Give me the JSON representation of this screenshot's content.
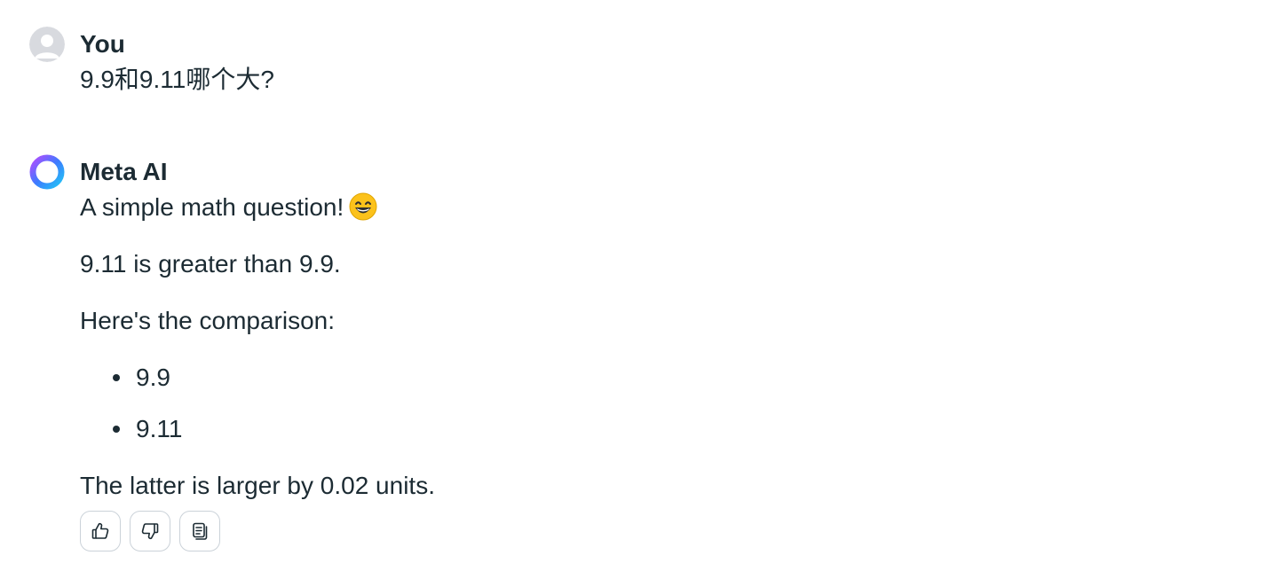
{
  "user_message": {
    "author": "You",
    "text": "9.9和9.11哪个大?",
    "avatar_icon": "default-user-avatar-icon"
  },
  "ai_message": {
    "author": "Meta AI",
    "avatar_icon": "meta-ai-ring-icon",
    "intro": "A simple math question!",
    "intro_emoji": "grinning-face-with-smiling-eyes-emoji",
    "answer": "9.11 is greater than 9.9.",
    "comparison_heading": "Here's the comparison:",
    "comparison_items": [
      "9.9",
      "9.11"
    ],
    "conclusion": "The latter is larger by 0.02 units."
  },
  "actions": {
    "like_icon": "thumbs-up-icon",
    "dislike_icon": "thumbs-down-icon",
    "copy_icon": "copy-icon"
  },
  "colors": {
    "text": "#1c2b33",
    "button_border": "#cbd2d9",
    "avatar_gray": "#d8dadf",
    "ring_gradient": [
      "#b24dff",
      "#3d7bff",
      "#22c3f5"
    ]
  }
}
